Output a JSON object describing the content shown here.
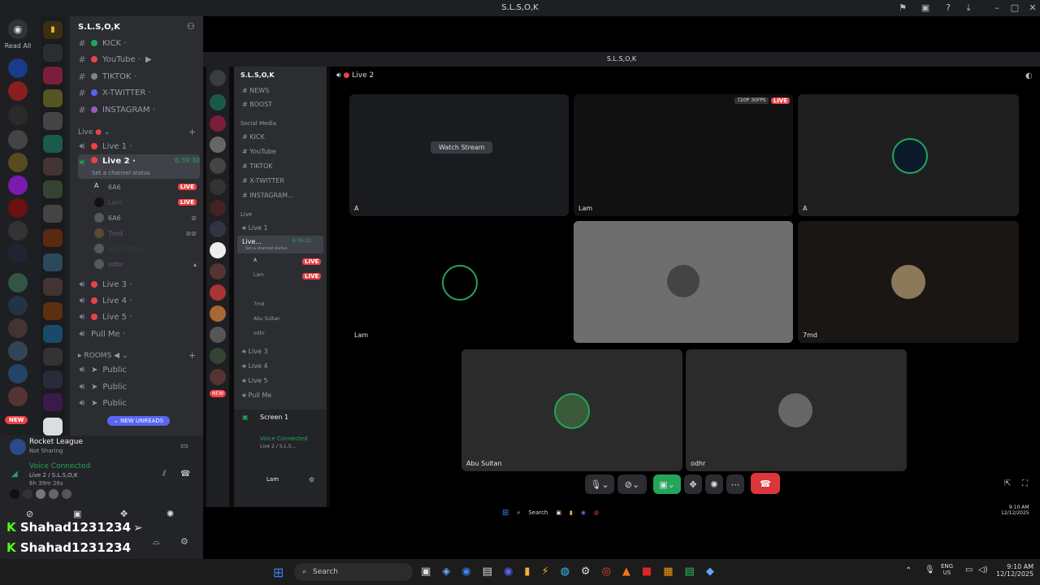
{
  "window": {
    "title": "S.L.S,O,K"
  },
  "rail": {
    "read_all": "Read All",
    "new_badge": "NEW"
  },
  "server": {
    "name": "S.L.S,O,K"
  },
  "channels_top": [
    {
      "name": "KICK ·"
    },
    {
      "name": "YouTube ·"
    },
    {
      "name": "TIKTOK ·"
    },
    {
      "name": "X-TWITTER ·"
    },
    {
      "name": "INSTAGRAM ·"
    }
  ],
  "live_category": "Live",
  "voice": {
    "live1": "Live 1 ·",
    "live2": "Live 2 ·",
    "live2_time": "6:39:30",
    "live2_status": "Set a channel status",
    "members": [
      {
        "name": "A",
        "tag": "6A6",
        "live": "LIVE"
      },
      {
        "name": "Lam",
        "tag": "",
        "live": "LIVE"
      },
      {
        "name": "",
        "tag": "6A6",
        "live": ""
      },
      {
        "name": "7md",
        "tag": "",
        "live": ""
      },
      {
        "name": "Abu Sultan",
        "tag": "",
        "live": ""
      },
      {
        "name": "odhr",
        "tag": "",
        "live": ""
      }
    ],
    "live3": "Live 3 ·",
    "live4": "Live 4 ·",
    "live5": "Live 5 ·",
    "pullme": "Pull Me ·"
  },
  "rooms": {
    "label": "ROOMS",
    "items": [
      "Public",
      "Public",
      "Public"
    ],
    "new_unreads": "NEW UNREADS"
  },
  "activity": {
    "game": "Rocket League",
    "status": "Not Sharing"
  },
  "voice_conn": {
    "label": "Voice Connected",
    "channel": "Live 2 / S.L.S,O,K",
    "elapsed": "6h 39m 26s"
  },
  "user_overlay": [
    "Shahad1231234",
    "Shahad1231234",
    "Shahad1231234"
  ],
  "inner": {
    "server": "S.L.S,O,K",
    "social_cat": "Social Media",
    "top": [
      "NEWS",
      "BOOST"
    ],
    "social": [
      "KICK",
      "YouTube",
      "TIKTOK",
      "X-TWITTER",
      "INSTAGRAM..."
    ],
    "live": "Live",
    "vc": [
      "Live 1",
      "Live...",
      "Live 3",
      "Live 4",
      "Live 5",
      "Pull Me"
    ],
    "time": "6:39:32",
    "status": "Set a channel status",
    "members": [
      "A",
      "Lam",
      "",
      "7md",
      "Abu Sultan",
      "odhr"
    ],
    "live_badge": "LIVE",
    "screen": "Screen 1",
    "voice": "Voice Connected",
    "voice_ch": "Live 2 / S.L.S...",
    "user": "Lam",
    "new": "NEW"
  },
  "call": {
    "header": "Live 2",
    "watch": "Watch Stream",
    "res": "720P 30FPS",
    "live": "LIVE",
    "tiles": [
      "A",
      "Lam",
      "A",
      "Lam",
      "",
      "7md",
      "Abu Sultan",
      "odhr"
    ]
  },
  "inner_taskbar": {
    "search": "Search",
    "time": "9:10 AM",
    "date": "12/12/2025"
  },
  "taskbar": {
    "search": "Search",
    "lang1": "ENG",
    "lang2": "US",
    "time": "9:10 AM",
    "date": "12/12/2025"
  }
}
